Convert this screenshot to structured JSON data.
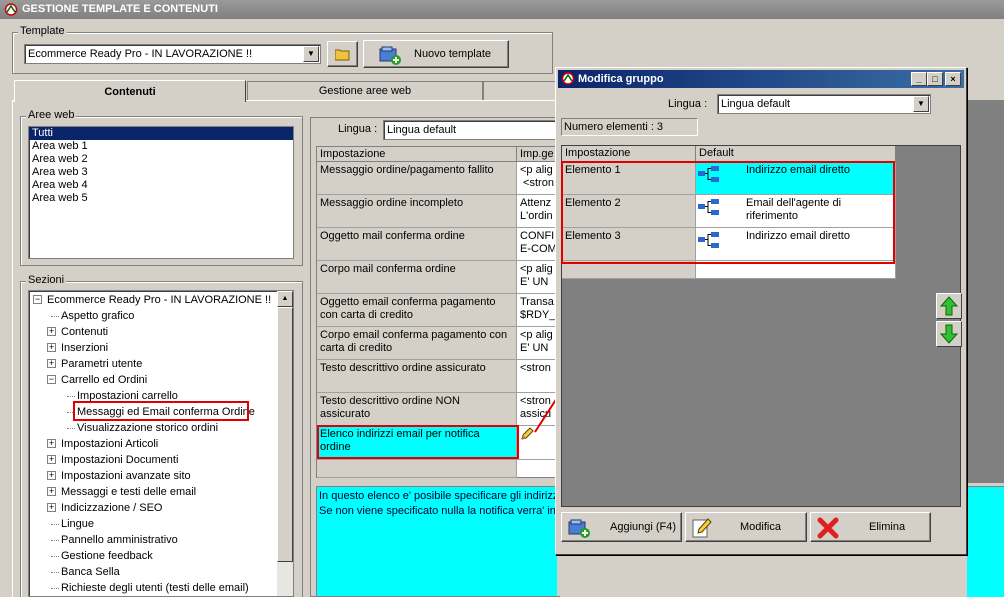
{
  "window": {
    "title": "GESTIONE TEMPLATE E CONTENUTI"
  },
  "template": {
    "group_label": "Template",
    "selected": "Ecommerce Ready Pro - IN LAVORAZIONE !!",
    "new_button": "Nuovo template"
  },
  "tabs": [
    {
      "label": "Contenuti",
      "active": true
    },
    {
      "label": "Gestione aree web",
      "active": false
    }
  ],
  "aree_web": {
    "label": "Aree web",
    "items": [
      "Tutti",
      "Area web 1",
      "Area web 2",
      "Area web 3",
      "Area web 4",
      "Area web 5"
    ],
    "selected_index": 0
  },
  "sezioni": {
    "label": "Sezioni",
    "tree": [
      {
        "label": "Ecommerce Ready Pro - IN LAVORAZIONE !!",
        "level": 0,
        "exp": "-"
      },
      {
        "label": "Aspetto grafico",
        "level": 1,
        "exp": ""
      },
      {
        "label": "Contenuti",
        "level": 1,
        "exp": "+"
      },
      {
        "label": "Inserzioni",
        "level": 1,
        "exp": "+"
      },
      {
        "label": "Parametri utente",
        "level": 1,
        "exp": "+"
      },
      {
        "label": "Carrello ed Ordini",
        "level": 1,
        "exp": "-"
      },
      {
        "label": "Impostazioni carrello",
        "level": 2,
        "exp": ""
      },
      {
        "label": "Messaggi ed Email conferma Ordine",
        "level": 2,
        "exp": ""
      },
      {
        "label": "Visualizzazione storico ordini",
        "level": 2,
        "exp": ""
      },
      {
        "label": "Impostazioni Articoli",
        "level": 1,
        "exp": "+"
      },
      {
        "label": "Impostazioni Documenti",
        "level": 1,
        "exp": "+"
      },
      {
        "label": "Impostazioni avanzate sito",
        "level": 1,
        "exp": "+"
      },
      {
        "label": "Messaggi e testi delle email",
        "level": 1,
        "exp": "+"
      },
      {
        "label": "Indicizzazione / SEO",
        "level": 1,
        "exp": "+"
      },
      {
        "label": "Lingue",
        "level": 1,
        "exp": ""
      },
      {
        "label": "Pannello amministrativo",
        "level": 1,
        "exp": ""
      },
      {
        "label": "Gestione feedback",
        "level": 1,
        "exp": ""
      },
      {
        "label": "Banca Sella",
        "level": 1,
        "exp": ""
      },
      {
        "label": "Richieste degli utenti (testi delle email)",
        "level": 1,
        "exp": ""
      }
    ]
  },
  "content": {
    "lingua_label": "Lingua :",
    "lingua_value": "Lingua default",
    "columns": [
      "Impostazione",
      "Imp.ge"
    ],
    "rows": [
      {
        "impostazione": "Messaggio ordine/pagamento fallito",
        "valore": "<p alig\n <stron"
      },
      {
        "impostazione": "Messaggio ordine incompleto",
        "valore": "Attenz\nL'ordin"
      },
      {
        "impostazione": "Oggetto mail conferma ordine",
        "valore": "CONFI\nE-COM"
      },
      {
        "impostazione": "Corpo mail conferma ordine",
        "valore": "<p alig\nE' UN"
      },
      {
        "impostazione": "Oggetto email conferma pagamento con carta di credito",
        "valore": "Transa\n$RDY_"
      },
      {
        "impostazione": "Corpo email conferma pagamento con carta di credito",
        "valore": "<p alig\nE' UN"
      },
      {
        "impostazione": "Testo descrittivo ordine assicurato",
        "valore": "<stron"
      },
      {
        "impostazione": "Testo descrittivo ordine NON assicurato",
        "valore": "<stron\nassicu"
      },
      {
        "impostazione": "Elenco indirizzi email per notifica ordine",
        "valore": ""
      }
    ],
    "description": "In questo elenco e' posibile specificare gli indirizz\nSe non viene specificato nulla la notifica verra' in"
  },
  "dialog": {
    "title": "Modifica gruppo",
    "lingua_label": "Lingua :",
    "lingua_value": "Lingua default",
    "count_label": "Numero elementi : 3",
    "columns": [
      "Impostazione",
      "Default"
    ],
    "rows": [
      {
        "name": "Elemento 1",
        "value": "Indirizzo email diretto"
      },
      {
        "name": "Elemento 2",
        "value": "Email dell'agente di riferimento"
      },
      {
        "name": "Elemento 3",
        "value": "Indirizzo email diretto"
      }
    ],
    "buttons": {
      "add": "Aggiungi (F4)",
      "edit": "Modifica",
      "delete": "Elimina"
    }
  },
  "colors": {
    "highlight": "#00ffff",
    "selection": "#0a246a",
    "annotation": "#e00000",
    "dark_area": "#808080"
  }
}
